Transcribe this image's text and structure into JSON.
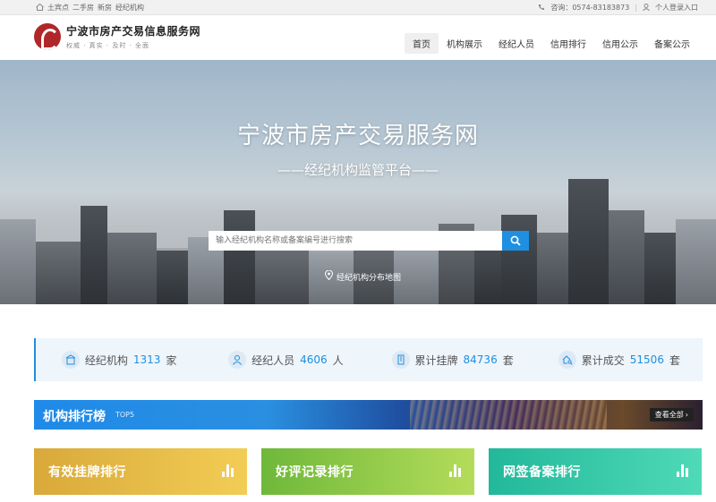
{
  "topbar": {
    "links": [
      "土宾点",
      "二手房",
      "新房",
      "经纪机构"
    ],
    "hotline": "咨询：0574-83183873",
    "login": "个人登录入口"
  },
  "header": {
    "site_name": "宁波市房产交易信息服务网",
    "slogan": "权威 · 真实 · 及时 · 全面",
    "nav": [
      "首页",
      "机构展示",
      "经纪人员",
      "信用排行",
      "信用公示",
      "备案公示"
    ]
  },
  "hero": {
    "title": "宁波市房产交易服务网",
    "subtitle": "——经纪机构监管平台——",
    "search_placeholder": "输入经纪机构名称或备案编号进行搜索",
    "map_link": "经纪机构分布地图"
  },
  "stats": [
    {
      "label": "经纪机构",
      "value": "1313",
      "unit": "家",
      "icon": "agency-icon"
    },
    {
      "label": "经纪人员",
      "value": "4606",
      "unit": "人",
      "icon": "person-icon"
    },
    {
      "label": "累计挂牌",
      "value": "84736",
      "unit": "套",
      "icon": "building-icon"
    },
    {
      "label": "累计成交",
      "value": "51506",
      "unit": "套",
      "icon": "search-house-icon"
    }
  ],
  "ranking": {
    "title": "机构排行榜",
    "tag": "TOP5",
    "more": "查看全部"
  },
  "cards": [
    "有效挂牌排行",
    "好评记录排行",
    "网签备案排行"
  ],
  "colors": {
    "accent": "#1e8fe1",
    "card1": "#e9bf48",
    "card2": "#8dc94a",
    "card3": "#33c9a6"
  }
}
